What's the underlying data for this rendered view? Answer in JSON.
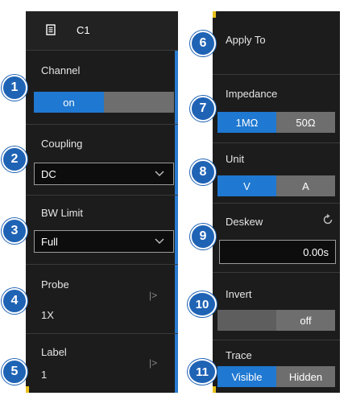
{
  "channel_header": {
    "title": "C1",
    "icon": "document-icon"
  },
  "left": {
    "channel": {
      "label": "Channel",
      "on": "on"
    },
    "coupling": {
      "label": "Coupling",
      "value": "DC"
    },
    "bw_limit": {
      "label": "BW Limit",
      "value": "Full"
    },
    "probe": {
      "label": "Probe",
      "value": "1X"
    },
    "label": {
      "label": "Label",
      "value": "1"
    }
  },
  "right": {
    "apply_to": {
      "label": "Apply To"
    },
    "impedance": {
      "label": "Impedance",
      "options": [
        "1MΩ",
        "50Ω"
      ],
      "selected": "1MΩ"
    },
    "unit": {
      "label": "Unit",
      "options": [
        "V",
        "A"
      ],
      "selected": "V"
    },
    "deskew": {
      "label": "Deskew",
      "value": "0.00s"
    },
    "invert": {
      "label": "Invert",
      "off": "off"
    },
    "trace": {
      "label": "Trace",
      "options": [
        "Visible",
        "Hidden"
      ],
      "selected": "Visible"
    }
  },
  "badges": [
    "1",
    "2",
    "3",
    "4",
    "5",
    "6",
    "7",
    "8",
    "9",
    "10",
    "11"
  ],
  "colors": {
    "accent": "#1f78d1",
    "panel": "#1c1c1c",
    "badge": "#1f63b5",
    "marker": "#e8c11a"
  }
}
